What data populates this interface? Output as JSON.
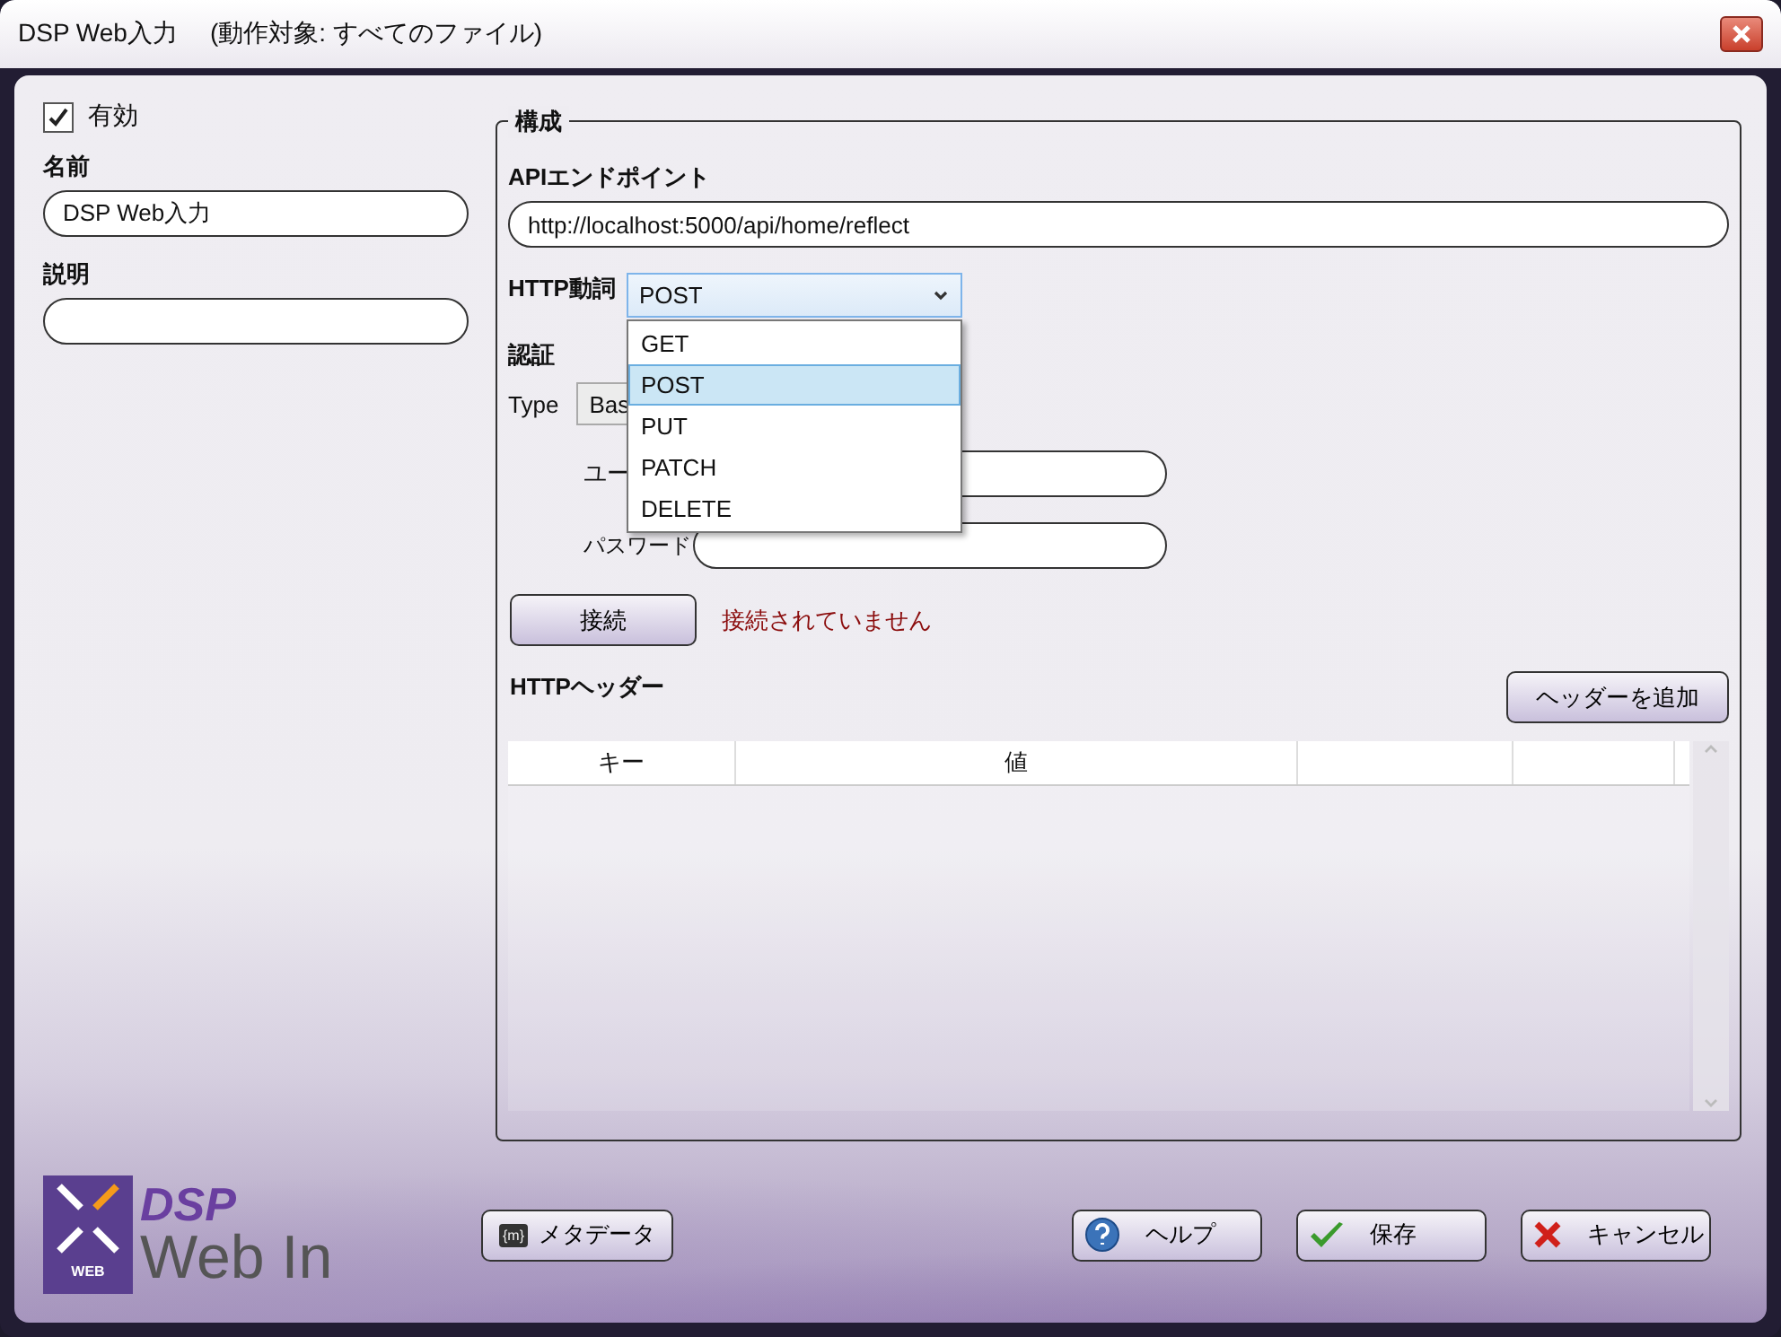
{
  "window": {
    "title": "DSP Web入力",
    "subtitle": "(動作対象: すべてのファイル)"
  },
  "enabled": {
    "label": "有効",
    "checked": true
  },
  "name": {
    "label": "名前",
    "value": "DSP Web入力"
  },
  "description": {
    "label": "説明"
  },
  "config": {
    "legend": "構成",
    "endpoint": {
      "label": "APIエンドポイント",
      "value": "http://localhost:5000/api/home/reflect"
    },
    "http_verb": {
      "label": "HTTP動詞",
      "value": "POST",
      "expanded": true,
      "options": [
        {
          "label": "GET",
          "selected": false
        },
        {
          "label": "POST",
          "selected": true
        },
        {
          "label": "PUT",
          "selected": false
        },
        {
          "label": "PATCH",
          "selected": false
        },
        {
          "label": "DELETE",
          "selected": false
        }
      ]
    },
    "auth": {
      "label": "認証",
      "type_label": "Type",
      "type_value": "Bas",
      "user_label": "ユー",
      "password_label": "パスワード"
    },
    "connect": {
      "button": "接続",
      "status": "接続されていません"
    },
    "headers": {
      "label": "HTTPヘッダー",
      "add_button": "ヘッダーを追加",
      "columns": [
        "キー",
        "値"
      ]
    }
  },
  "logo": {
    "badge": "WEB",
    "line1": "DSP",
    "line2": "Web In"
  },
  "buttons": [
    {
      "kind": "metadata",
      "label": "メタデータ",
      "icon_text": "{m}"
    },
    {
      "kind": "help",
      "label": "ヘルプ"
    },
    {
      "kind": "save",
      "label": "保存"
    },
    {
      "kind": "cancel",
      "label": "キャンセル"
    }
  ]
}
